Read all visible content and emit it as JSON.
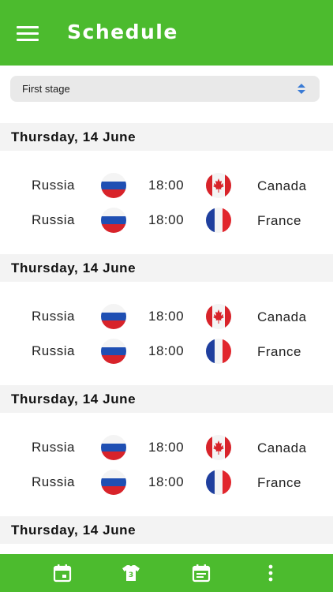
{
  "appbar": {
    "title": "Schedule"
  },
  "stage": {
    "selected": "First stage"
  },
  "days": [
    {
      "date": "Thursday, 14 June",
      "matches": [
        {
          "home": "Russia",
          "time": "18:00",
          "away": "Canada",
          "home_flag": "russia-flag",
          "away_flag": "canada-flag"
        },
        {
          "home": "Russia",
          "time": "18:00",
          "away": "France",
          "home_flag": "russia-flag",
          "away_flag": "france-flag"
        }
      ]
    },
    {
      "date": "Thursday, 14 June",
      "matches": [
        {
          "home": "Russia",
          "time": "18:00",
          "away": "Canada",
          "home_flag": "russia-flag",
          "away_flag": "canada-flag"
        },
        {
          "home": "Russia",
          "time": "18:00",
          "away": "France",
          "home_flag": "russia-flag",
          "away_flag": "france-flag"
        }
      ]
    },
    {
      "date": "Thursday, 14 June",
      "matches": [
        {
          "home": "Russia",
          "time": "18:00",
          "away": "Canada",
          "home_flag": "russia-flag",
          "away_flag": "canada-flag"
        },
        {
          "home": "Russia",
          "time": "18:00",
          "away": "France",
          "home_flag": "russia-flag",
          "away_flag": "france-flag"
        }
      ]
    },
    {
      "date": "Thursday, 14 June",
      "matches": []
    }
  ],
  "bottom_nav": [
    "calendar-icon",
    "group-shirt-icon",
    "schedule-icon",
    "more-vertical-icon"
  ],
  "colors": {
    "accent": "#4cbb2e",
    "header_bg": "#f3f3f3",
    "select_bg": "#e9e9e9"
  }
}
